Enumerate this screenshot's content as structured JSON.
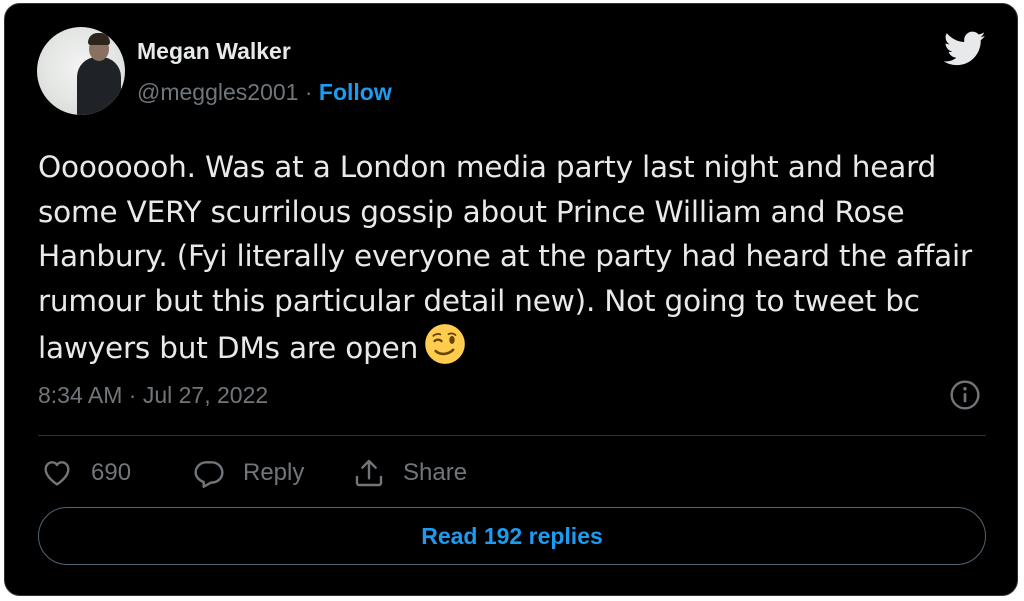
{
  "author": {
    "name": "Megan Walker",
    "handle": "@meggles2001",
    "separator": " · ",
    "follow_label": "Follow"
  },
  "tweet": {
    "text": "Oooooooh. Was at a London media party last night and heard some VERY scurrilous gossip about Prince William and Rose Hanbury. (Fyi literally everyone at the party had heard the affair rumour but this particular detail new). Not going to tweet bc lawyers but DMs are open",
    "emoji": "winking-face",
    "timestamp": "8:34 AM · Jul 27, 2022"
  },
  "actions": {
    "like_count": "690",
    "reply_label": "Reply",
    "share_label": "Share"
  },
  "read_replies_label": "Read 192 replies",
  "icons": {
    "brand": "twitter-bird-icon",
    "info": "info-icon",
    "like": "heart-icon",
    "reply": "speech-bubble-icon",
    "share": "upload-arrow-icon"
  },
  "colors": {
    "background": "#000000",
    "text": "#e7e9ea",
    "muted": "#71767b",
    "accent": "#1d9bf0",
    "border": "#2f3336"
  }
}
